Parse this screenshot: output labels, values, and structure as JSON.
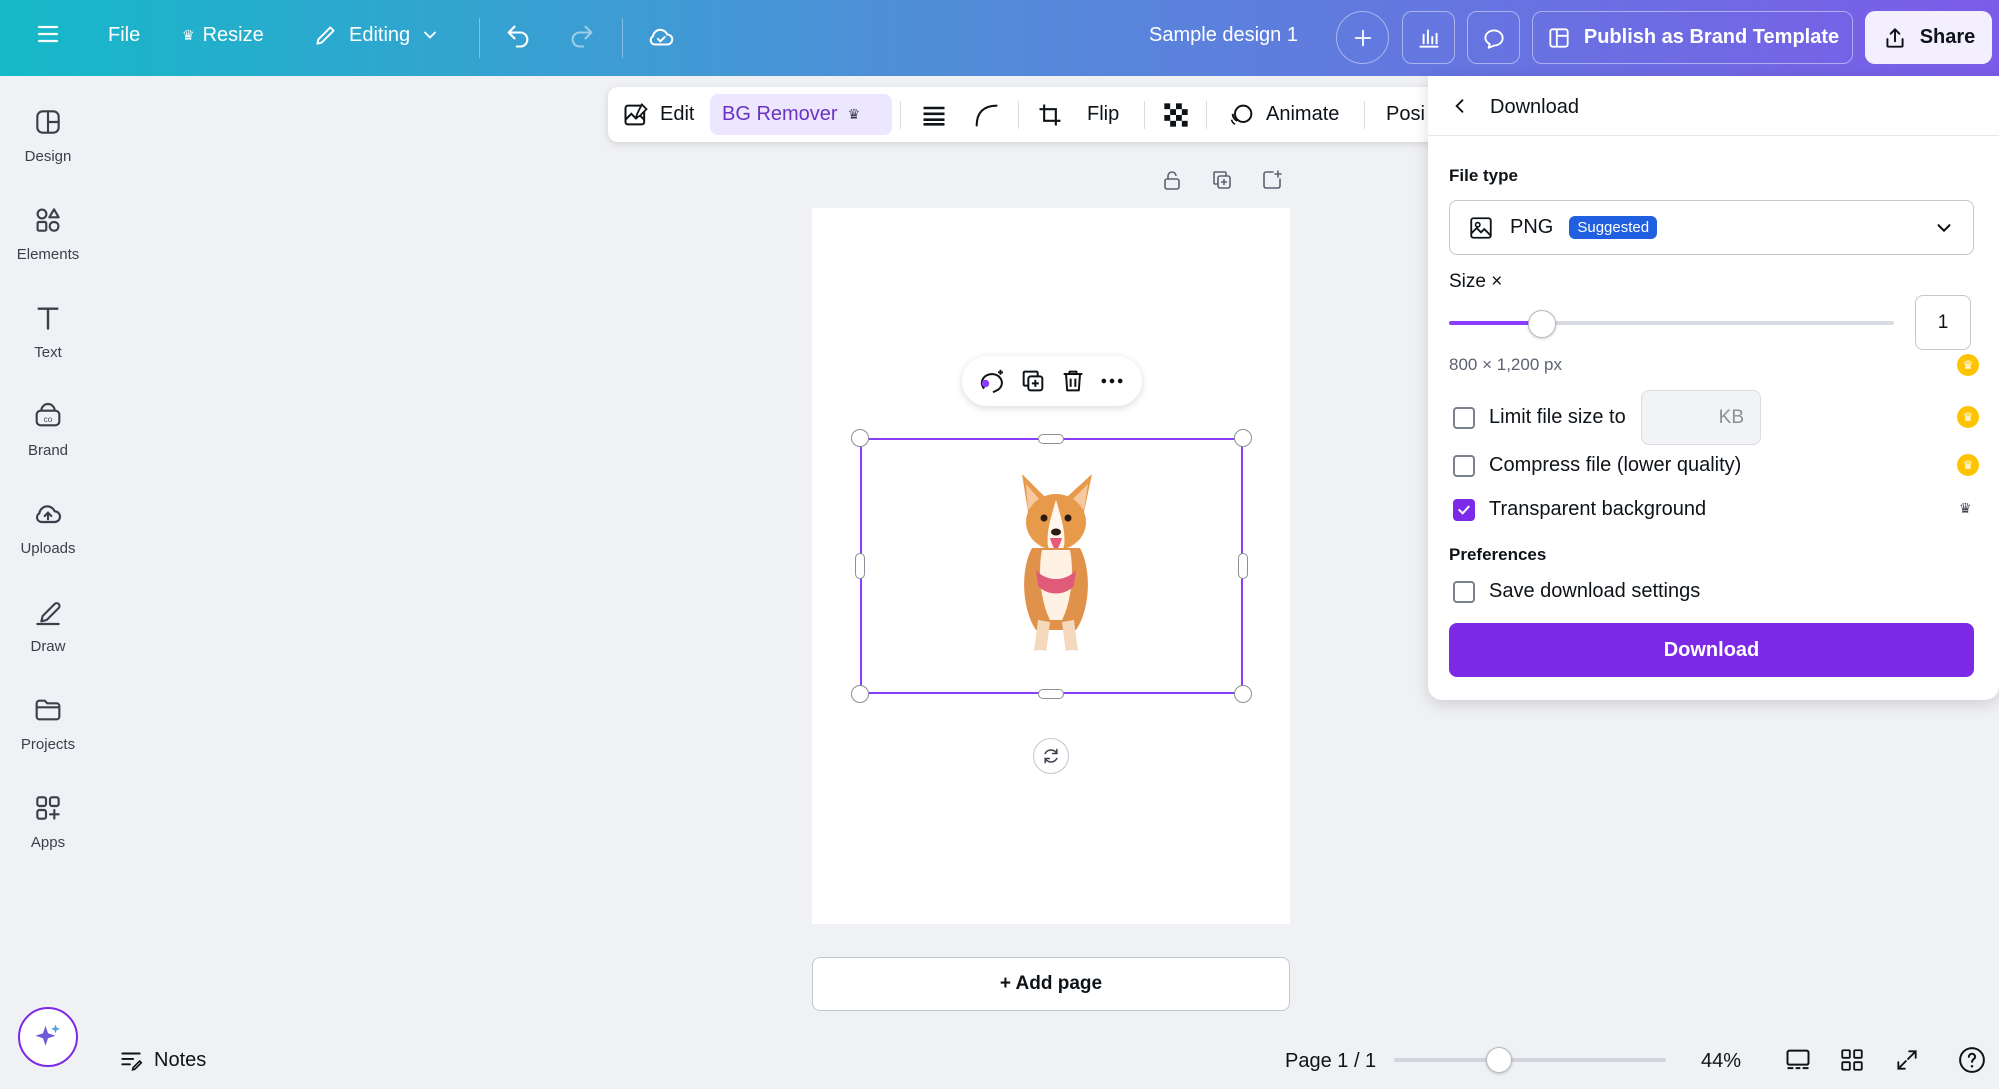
{
  "topbar": {
    "file_label": "File",
    "resize_label": "Resize",
    "editing_label": "Editing",
    "design_title": "Sample design 1",
    "publish_label": "Publish as Brand Template",
    "share_label": "Share"
  },
  "sidebar": {
    "items": [
      {
        "label": "Design"
      },
      {
        "label": "Elements"
      },
      {
        "label": "Text"
      },
      {
        "label": "Brand"
      },
      {
        "label": "Uploads"
      },
      {
        "label": "Draw"
      },
      {
        "label": "Projects"
      },
      {
        "label": "Apps"
      }
    ]
  },
  "context_toolbar": {
    "edit_label": "Edit",
    "bg_remover_label": "BG Remover",
    "flip_label": "Flip",
    "animate_label": "Animate",
    "position_label": "Posi"
  },
  "canvas": {
    "add_page_label": "+ Add page"
  },
  "bottom": {
    "notes_label": "Notes",
    "page_count": "Page 1 / 1",
    "zoom": "44%"
  },
  "download_panel": {
    "title": "Download",
    "file_type_label": "File type",
    "file_type_value": "PNG",
    "suggested_badge": "Suggested",
    "size_label": "Size ×",
    "size_value": "1",
    "dimensions": "800 × 1,200 px",
    "limit_label": "Limit file size to",
    "kb_placeholder": "KB",
    "compress_label": "Compress file (lower quality)",
    "transparent_label": "Transparent background",
    "preferences_label": "Preferences",
    "save_settings_label": "Save download settings",
    "download_button": "Download",
    "transparent_checked": true
  },
  "colors": {
    "accent": "#7d2ae8",
    "badge": "#1f5fe0",
    "crown": "#ffc400"
  }
}
